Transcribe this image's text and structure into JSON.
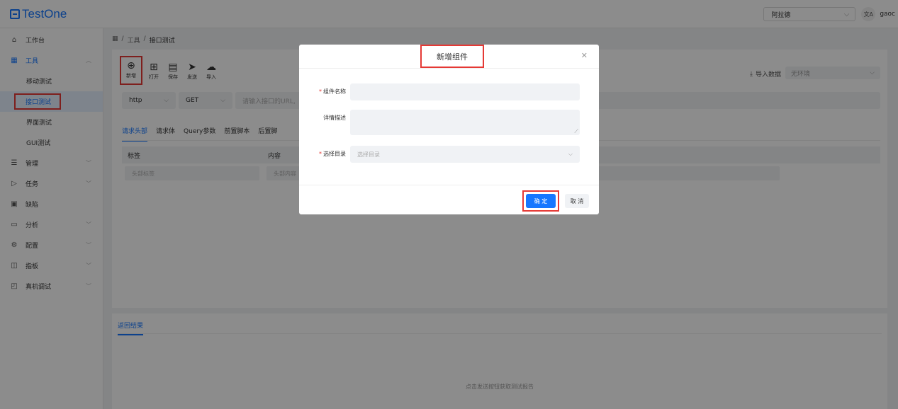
{
  "app": {
    "logo_text": "TestOne"
  },
  "header": {
    "env_select": "阿拉德",
    "lang_icon": "translate-icon",
    "user": "gaoc"
  },
  "sidebar": {
    "items": [
      {
        "label": "工作台",
        "icon": "home-icon"
      },
      {
        "label": "工具",
        "icon": "grid-icon",
        "children": [
          "移动测试",
          "接口测试",
          "界面测试",
          "GUI测试"
        ]
      },
      {
        "label": "管理",
        "icon": "list-icon"
      },
      {
        "label": "任务",
        "icon": "play-icon"
      },
      {
        "label": "缺陷",
        "icon": "bug-icon"
      },
      {
        "label": "分析",
        "icon": "calendar-icon"
      },
      {
        "label": "配置",
        "icon": "settings-icon"
      },
      {
        "label": "指板",
        "icon": "board-icon"
      },
      {
        "label": "真机调试",
        "icon": "device-icon"
      }
    ],
    "active_child": "接口测试"
  },
  "breadcrumb": {
    "root_icon": "grid-icon",
    "sep": "/",
    "level1": "工具",
    "level2": "接口测试"
  },
  "toolbar": {
    "new": "新增",
    "open": "打开",
    "save": "保存",
    "send": "发送",
    "import": "导入",
    "import_data": "导入数据",
    "env": "无环境"
  },
  "request": {
    "protocol": "http",
    "method": "GET",
    "url_placeholder": "请输入接口的URL,"
  },
  "tabs": [
    "请求头部",
    "请求体",
    "Query参数",
    "前置脚本",
    "后置脚"
  ],
  "headers_table": {
    "columns": [
      "标签",
      "内容"
    ],
    "row_placeholders": [
      "头部标签",
      "头部内容"
    ]
  },
  "result": {
    "tab": "返回结果",
    "empty": "点击发送按钮获取测试报告"
  },
  "modal": {
    "title": "新增组件",
    "fields": {
      "name_label": "组件名称",
      "desc_label": "详情描述",
      "dir_label": "选择目录",
      "dir_placeholder": "选择目录"
    },
    "ok": "确 定",
    "cancel": "取 消"
  }
}
